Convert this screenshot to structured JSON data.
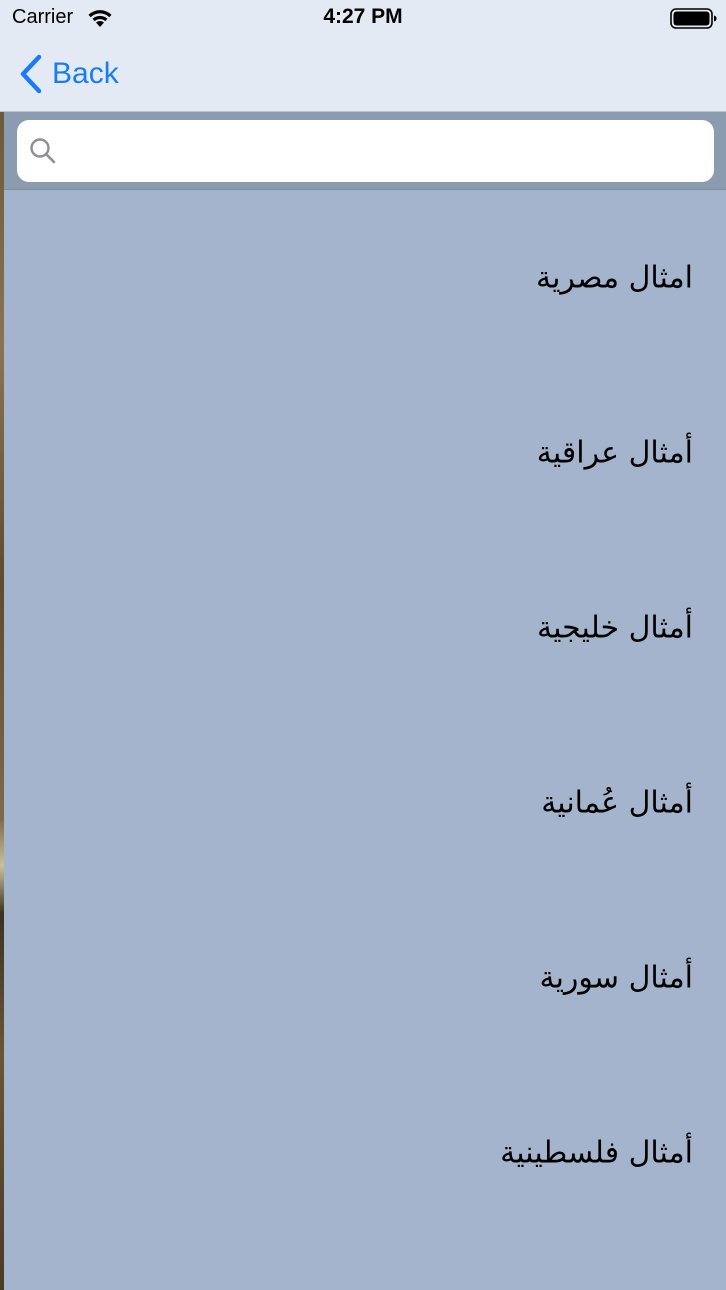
{
  "status_bar": {
    "carrier": "Carrier",
    "time": "4:27 PM",
    "wifi_icon": "wifi-icon",
    "battery_icon": "battery-full-icon"
  },
  "nav": {
    "back_label": "Back",
    "back_icon": "chevron-left-icon",
    "accent_color": "#1a7cf5"
  },
  "search": {
    "icon": "search-icon",
    "value": "",
    "placeholder": ""
  },
  "list": {
    "background_color": "#a3b4cc",
    "items": [
      {
        "label": "امثال مصرية"
      },
      {
        "label": "أمثال عراقية"
      },
      {
        "label": "أمثال خليجية"
      },
      {
        "label": "أمثال عُمانية"
      },
      {
        "label": "أمثال سورية"
      },
      {
        "label": "أمثال فلسطينية"
      }
    ]
  }
}
